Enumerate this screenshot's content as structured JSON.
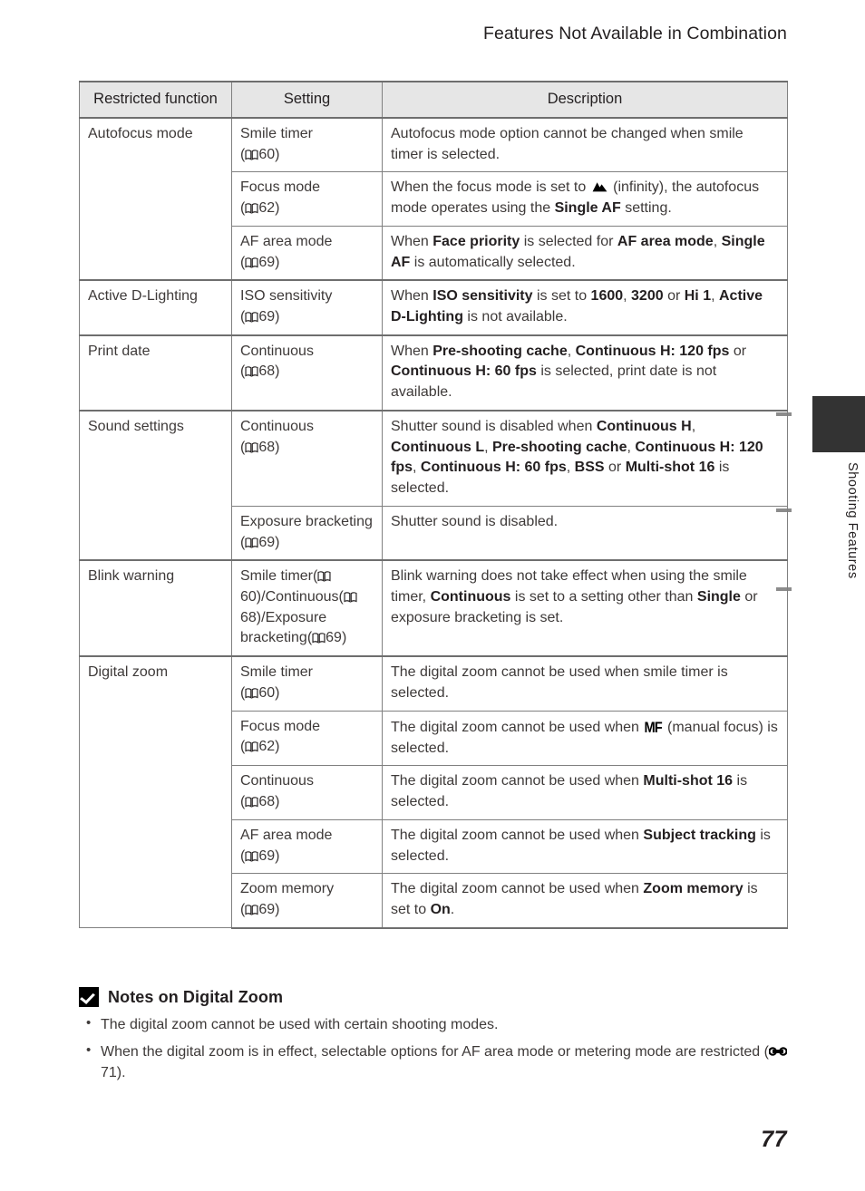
{
  "header": {
    "running_title": "Features Not Available in Combination"
  },
  "side_tab": {
    "label": "Shooting Features"
  },
  "folio": {
    "page_number": "77"
  },
  "table": {
    "columns": [
      "Restricted function",
      "Setting",
      "Description"
    ],
    "groups": [
      {
        "function": "Autofocus mode",
        "rows": [
          {
            "setting": "Smile timer",
            "setting_ref": "60",
            "description_parts": [
              {
                "t": "Autofocus mode option cannot be changed when smile timer is selected.",
                "b": false
              }
            ]
          },
          {
            "setting": "Focus mode",
            "setting_ref": "62",
            "description_parts": [
              {
                "t": "When the focus mode is set to ",
                "b": false
              },
              {
                "icon": "mountain-icon"
              },
              {
                "t": " (infinity), the autofocus mode operates using the ",
                "b": false
              },
              {
                "t": "Single AF",
                "b": true
              },
              {
                "t": " setting.",
                "b": false
              }
            ]
          },
          {
            "setting": "AF area mode",
            "setting_ref": "69",
            "description_parts": [
              {
                "t": "When ",
                "b": false
              },
              {
                "t": "Face priority",
                "b": true
              },
              {
                "t": " is selected for ",
                "b": false
              },
              {
                "t": "AF area mode",
                "b": true
              },
              {
                "t": ", ",
                "b": false
              },
              {
                "t": "Single AF",
                "b": true
              },
              {
                "t": " is automatically selected.",
                "b": false
              }
            ]
          }
        ]
      },
      {
        "function": "Active D-Lighting",
        "rows": [
          {
            "setting": "ISO sensitivity",
            "setting_ref": "69",
            "description_parts": [
              {
                "t": "When ",
                "b": false
              },
              {
                "t": "ISO sensitivity",
                "b": true
              },
              {
                "t": " is set to ",
                "b": false
              },
              {
                "t": "1600",
                "b": true
              },
              {
                "t": ", ",
                "b": false
              },
              {
                "t": "3200",
                "b": true
              },
              {
                "t": " or ",
                "b": false
              },
              {
                "t": "Hi 1",
                "b": true
              },
              {
                "t": ", ",
                "b": false
              },
              {
                "t": "Active D-Lighting",
                "b": true
              },
              {
                "t": " is not available.",
                "b": false
              }
            ]
          }
        ]
      },
      {
        "function": "Print date",
        "rows": [
          {
            "setting": "Continuous",
            "setting_ref": "68",
            "description_parts": [
              {
                "t": "When ",
                "b": false
              },
              {
                "t": "Pre-shooting cache",
                "b": true
              },
              {
                "t": ", ",
                "b": false
              },
              {
                "t": "Continuous H: 120 fps",
                "b": true
              },
              {
                "t": " or ",
                "b": false
              },
              {
                "t": "Continuous H: 60 fps",
                "b": true
              },
              {
                "t": " is selected, print date is not available.",
                "b": false
              }
            ]
          }
        ]
      },
      {
        "function": "Sound settings",
        "rows": [
          {
            "setting": "Continuous",
            "setting_ref": "68",
            "description_parts": [
              {
                "t": "Shutter sound is disabled when ",
                "b": false
              },
              {
                "t": "Continuous H",
                "b": true
              },
              {
                "t": ", ",
                "b": false
              },
              {
                "t": "Continuous L",
                "b": true
              },
              {
                "t": ", ",
                "b": false
              },
              {
                "t": "Pre-shooting cache",
                "b": true
              },
              {
                "t": ", ",
                "b": false
              },
              {
                "t": "Continuous H: 120 fps",
                "b": true
              },
              {
                "t": ", ",
                "b": false
              },
              {
                "t": "Continuous H: 60 fps",
                "b": true
              },
              {
                "t": ", ",
                "b": false
              },
              {
                "t": "BSS",
                "b": true
              },
              {
                "t": " or ",
                "b": false
              },
              {
                "t": "Multi-shot 16",
                "b": true
              },
              {
                "t": " is selected.",
                "b": false
              }
            ]
          },
          {
            "setting": "Exposure bracketing",
            "setting_ref": "69",
            "description_parts": [
              {
                "t": "Shutter sound is disabled.",
                "b": false
              }
            ]
          }
        ]
      },
      {
        "function": "Blink warning",
        "rows": [
          {
            "setting_composite": [
              {
                "t": "Smile timer"
              },
              {
                "ref": "60"
              },
              {
                "t": "/"
              },
              {
                "t": "Continuous"
              },
              {
                "ref": "68"
              },
              {
                "t": "/Exposure bracketing"
              },
              {
                "ref": "69"
              }
            ],
            "setting_plain": "Smile timer (60)/Continuous (68)/Exposure bracketing (69)",
            "description_parts": [
              {
                "t": "Blink warning does not take effect when using the smile timer, ",
                "b": false
              },
              {
                "t": "Continuous",
                "b": true
              },
              {
                "t": " is set to a setting other than ",
                "b": false
              },
              {
                "t": "Single",
                "b": true
              },
              {
                "t": " or exposure bracketing is set.",
                "b": false
              }
            ]
          }
        ]
      },
      {
        "function": "Digital zoom",
        "rows": [
          {
            "setting": "Smile timer",
            "setting_ref": "60",
            "description_parts": [
              {
                "t": "The digital zoom cannot be used when smile timer is selected.",
                "b": false
              }
            ]
          },
          {
            "setting": "Focus mode",
            "setting_ref": "62",
            "description_parts": [
              {
                "t": "The digital zoom cannot be used when ",
                "b": false
              },
              {
                "icon": "manual-focus-icon"
              },
              {
                "t": " (manual focus) is selected.",
                "b": false
              }
            ]
          },
          {
            "setting": "Continuous",
            "setting_ref": "68",
            "description_parts": [
              {
                "t": "The digital zoom cannot be used when ",
                "b": false
              },
              {
                "t": "Multi-shot 16",
                "b": true
              },
              {
                "t": " is selected.",
                "b": false
              }
            ]
          },
          {
            "setting": "AF area mode",
            "setting_ref": "69",
            "description_parts": [
              {
                "t": "The digital zoom cannot be used when ",
                "b": false
              },
              {
                "t": "Subject tracking",
                "b": true
              },
              {
                "t": " is selected.",
                "b": false
              }
            ]
          },
          {
            "setting": "Zoom memory",
            "setting_ref": "69",
            "description_parts": [
              {
                "t": "The digital zoom cannot be used when ",
                "b": false
              },
              {
                "t": "Zoom memory",
                "b": true
              },
              {
                "t": " is set to ",
                "b": false
              },
              {
                "t": "On",
                "b": true
              },
              {
                "t": ".",
                "b": false
              }
            ]
          }
        ]
      }
    ]
  },
  "notes": {
    "title": "Notes on Digital Zoom",
    "items": [
      {
        "parts": [
          {
            "t": "The digital zoom cannot be used with certain shooting modes.",
            "b": false
          }
        ]
      },
      {
        "parts": [
          {
            "t": "When the digital zoom is in effect, selectable options for AF area mode or metering mode are restricted (",
            "b": false
          },
          {
            "icon": "advanced-reference-icon"
          },
          {
            "t": "71).",
            "b": false
          }
        ]
      }
    ]
  }
}
